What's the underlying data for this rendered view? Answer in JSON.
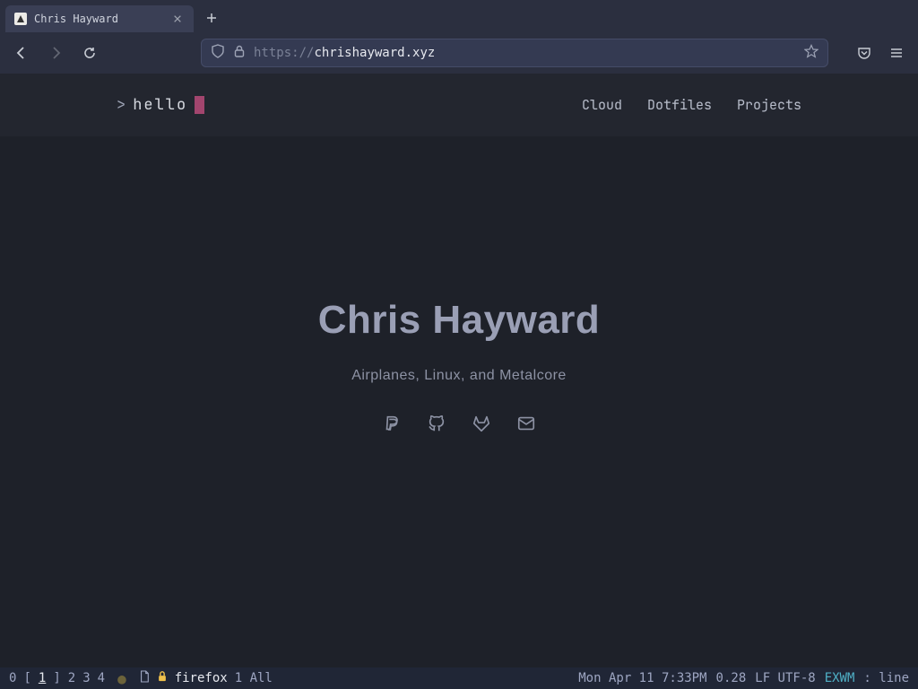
{
  "browser": {
    "tab_title": "Chris Hayward",
    "address_protocol": "https://",
    "address_domain": "chrishayward.xyz"
  },
  "site": {
    "logo_prompt": ">",
    "logo_text": "hello",
    "nav": [
      "Cloud",
      "Dotfiles",
      "Projects"
    ]
  },
  "hero": {
    "name": "Chris Hayward",
    "tagline": "Airplanes, Linux, and Metalcore"
  },
  "social_icons": [
    "paypal",
    "github",
    "gitlab",
    "mail"
  ],
  "modeline": {
    "workspaces": [
      "0",
      "1",
      "2",
      "3",
      "4"
    ],
    "active_workspace": 1,
    "buffer_name": "firefox",
    "position": "1 All",
    "datetime": "Mon Apr 11 7:33PM",
    "load": "0.28",
    "encoding": "LF UTF-8",
    "major_mode": "EXWM",
    "trailing": ": line"
  }
}
